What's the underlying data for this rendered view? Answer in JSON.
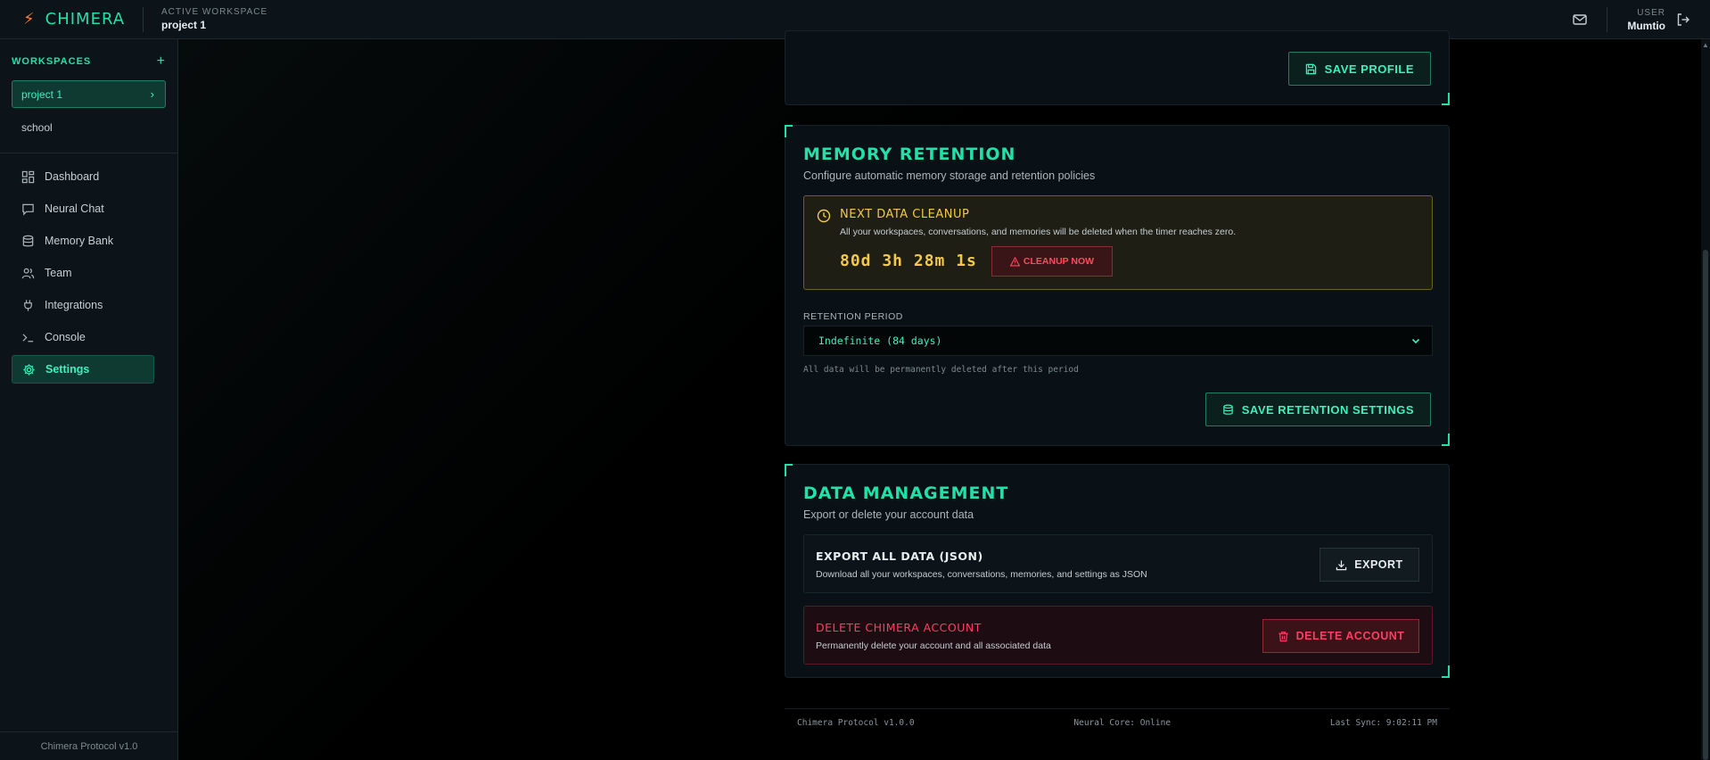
{
  "app": {
    "name": "CHIMERA",
    "version_footer": "Chimera Protocol v1.0"
  },
  "topbar": {
    "workspace_caption": "ACTIVE WORKSPACE",
    "workspace_value": "project 1",
    "user_caption": "USER",
    "user_value": "Mumtio"
  },
  "sidebar": {
    "workspaces_title": "WORKSPACES",
    "workspaces": [
      {
        "label": "project 1",
        "active": true
      },
      {
        "label": "school",
        "active": false
      }
    ],
    "nav": [
      {
        "label": "Dashboard",
        "icon": "dashboard-icon"
      },
      {
        "label": "Neural Chat",
        "icon": "chat-icon"
      },
      {
        "label": "Memory Bank",
        "icon": "database-icon"
      },
      {
        "label": "Team",
        "icon": "users-icon"
      },
      {
        "label": "Integrations",
        "icon": "plug-icon"
      },
      {
        "label": "Console",
        "icon": "terminal-icon"
      },
      {
        "label": "Settings",
        "icon": "gear-icon",
        "active": true
      }
    ]
  },
  "profile_card": {
    "save_label": "SAVE PROFILE"
  },
  "memory_retention": {
    "title": "MEMORY RETENTION",
    "subtitle": "Configure automatic memory storage and retention policies",
    "cleanup": {
      "title": "NEXT DATA CLEANUP",
      "description": "All your workspaces, conversations, and memories will be deleted when the timer reaches zero.",
      "timer": "80d 3h 28m 1s",
      "button_label": "CLEANUP NOW"
    },
    "retention_label": "RETENTION PERIOD",
    "retention_value": "Indefinite (84 days)",
    "retention_hint": "All data will be permanently deleted after this period",
    "save_label": "SAVE RETENTION SETTINGS"
  },
  "data_management": {
    "title": "DATA MANAGEMENT",
    "subtitle": "Export or delete your account data",
    "export": {
      "title": "EXPORT ALL DATA (JSON)",
      "description": "Download all your workspaces, conversations, memories, and settings as JSON",
      "button_label": "EXPORT"
    },
    "delete": {
      "title": "DELETE CHIMERA ACCOUNT",
      "description": "Permanently delete your account and all associated data",
      "button_label": "DELETE ACCOUNT"
    }
  },
  "status_bar": {
    "left": "Chimera Protocol v1.0.0",
    "center": "Neural Core: Online",
    "right": "Last Sync: 9:02:11 PM"
  },
  "colors": {
    "accent": "#22e0a8",
    "warning": "#f2c94c",
    "danger": "#ff3d62",
    "background": "#000000",
    "panel": "#0d1419"
  }
}
